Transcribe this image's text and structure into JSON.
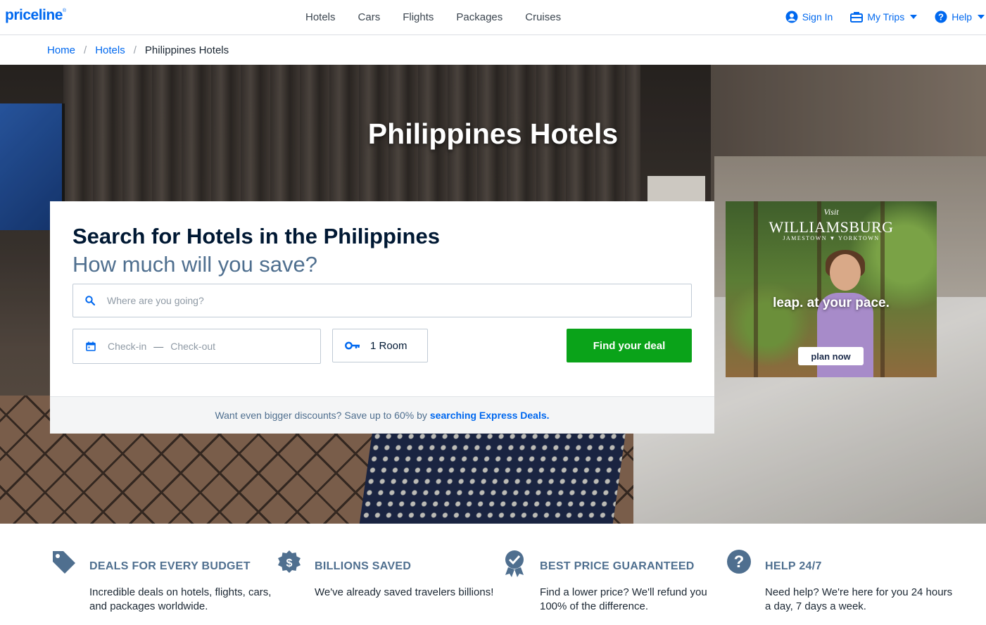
{
  "header": {
    "logo": "priceline",
    "logo_mark": "®",
    "nav": [
      "Hotels",
      "Cars",
      "Flights",
      "Packages",
      "Cruises"
    ],
    "sign_in": "Sign In",
    "my_trips": "My Trips",
    "help": "Help"
  },
  "breadcrumb": {
    "home": "Home",
    "hotels": "Hotels",
    "current": "Philippines Hotels"
  },
  "hero": {
    "title": "Philippines Hotels"
  },
  "search": {
    "title": "Search for Hotels in the Philippines",
    "subtitle": "How much will you save?",
    "destination_placeholder": "Where are you going?",
    "check_in": "Check-in",
    "check_out": "Check-out",
    "rooms": "1 Room",
    "submit": "Find your deal",
    "footer_text": "Want even bigger discounts? Save up to 60% by",
    "footer_link": "searching Express Deals."
  },
  "ad": {
    "visit": "Visit",
    "brand": "WILLIAMSBURG",
    "sub": "JAMESTOWN ▼ YORKTOWN",
    "tagline": "leap. at your pace.",
    "button": "plan now"
  },
  "features": [
    {
      "icon": "price-tag-icon",
      "title": "DEALS FOR EVERY BUDGET",
      "text": "Incredible deals on hotels, flights, cars, and packages worldwide."
    },
    {
      "icon": "dollar-badge-icon",
      "title": "BILLIONS SAVED",
      "text": "We've already saved travelers billions!"
    },
    {
      "icon": "checkmark-badge-icon",
      "title": "BEST PRICE GUARANTEED",
      "text": "Find a lower price? We'll refund you 100% of the difference."
    },
    {
      "icon": "question-circle-icon",
      "title": "HELP 24/7",
      "text": "Need help? We're here for you 24 hours a day, 7 days a week."
    }
  ],
  "colors": {
    "brand_blue": "#0068ef",
    "cta_green": "#0aa319",
    "feature_slate": "#4f6f8f"
  }
}
